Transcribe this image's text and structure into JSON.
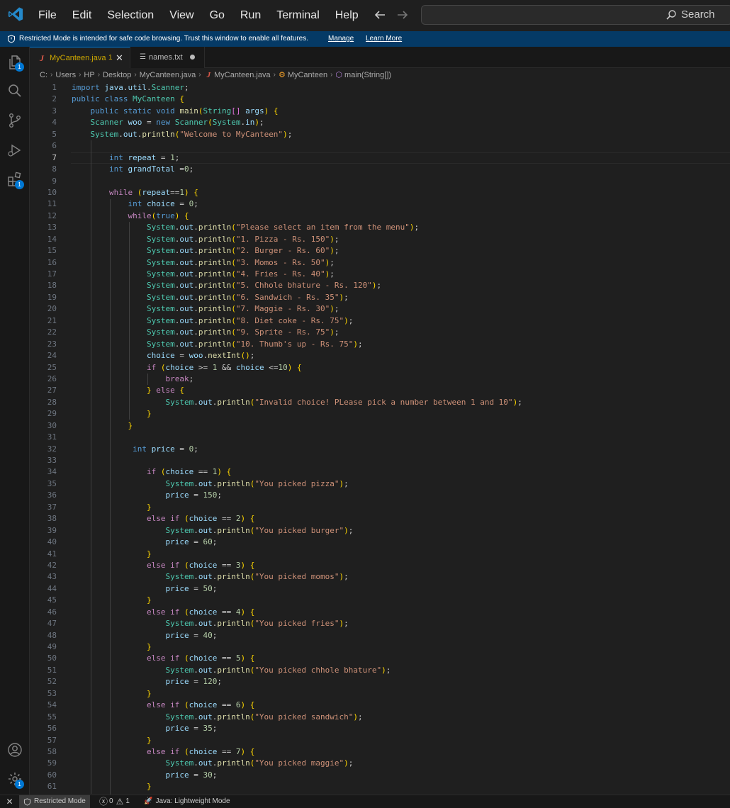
{
  "menu": [
    "File",
    "Edit",
    "Selection",
    "View",
    "Go",
    "Run",
    "Terminal",
    "Help"
  ],
  "search": {
    "label": "Search"
  },
  "banner": {
    "text": "Restricted Mode is intended for safe code browsing. Trust this window to enable all features.",
    "manage": "Manage",
    "learn_more": "Learn More"
  },
  "activity_badges": {
    "explorer": "1",
    "extensions": "1",
    "settings": "1"
  },
  "tabs": [
    {
      "label": "MyCanteen.java",
      "count": "1",
      "close": "✕"
    },
    {
      "label": "names.txt"
    }
  ],
  "breadcrumb": [
    "C:",
    "Users",
    "HP",
    "Desktop",
    "MyCanteen.java",
    "MyCanteen.java",
    "MyCanteen",
    "main(String[])"
  ],
  "editor": {
    "active_line": 7,
    "lines": [
      "import java.util.Scanner;",
      "public class MyCanteen {",
      "    public static void main(String[] args) {",
      "    Scanner woo = new Scanner(System.in);",
      "    System.out.println(\"Welcome to MyCanteen\");",
      "",
      "        int repeat = 1;",
      "        int grandTotal =0;",
      "",
      "        while (repeat==1) {",
      "            int choice = 0;",
      "            while(true) {",
      "                System.out.println(\"Please select an item from the menu\");",
      "                System.out.println(\"1. Pizza - Rs. 150\");",
      "                System.out.println(\"2. Burger - Rs. 60\");",
      "                System.out.println(\"3. Momos - Rs. 50\");",
      "                System.out.println(\"4. Fries - Rs. 40\");",
      "                System.out.println(\"5. Chhole bhature - Rs. 120\");",
      "                System.out.println(\"6. Sandwich - Rs. 35\");",
      "                System.out.println(\"7. Maggie - Rs. 30\");",
      "                System.out.println(\"8. Diet coke - Rs. 75\");",
      "                System.out.println(\"9. Sprite - Rs. 75\");",
      "                System.out.println(\"10. Thumb's up - Rs. 75\");",
      "                choice = woo.nextInt();",
      "                if (choice >= 1 && choice <=10) {",
      "                    break;",
      "                } else {",
      "                    System.out.println(\"Invalid choice! PLease pick a number between 1 and 10\");",
      "                }",
      "            }",
      "",
      "             int price = 0;",
      "",
      "                if (choice == 1) {",
      "                    System.out.println(\"You picked pizza\");",
      "                    price = 150;",
      "                }",
      "                else if (choice == 2) {",
      "                    System.out.println(\"You picked burger\");",
      "                    price = 60;",
      "                }",
      "                else if (choice == 3) {",
      "                    System.out.println(\"You picked momos\");",
      "                    price = 50;",
      "                }",
      "                else if (choice == 4) {",
      "                    System.out.println(\"You picked fries\");",
      "                    price = 40;",
      "                }",
      "                else if (choice == 5) {",
      "                    System.out.println(\"You picked chhole bhature\");",
      "                    price = 120;",
      "                }",
      "                else if (choice == 6) {",
      "                    System.out.println(\"You picked sandwich\");",
      "                    price = 35;",
      "                }",
      "                else if (choice == 7) {",
      "                    System.out.println(\"You picked maggie\");",
      "                    price = 30;",
      "                }"
    ]
  },
  "status": {
    "remote": "✕",
    "restricted": "Restricted Mode",
    "errors": "0",
    "warnings": "1",
    "java": "Java: Lightweight Mode"
  },
  "colors": {
    "accent": "#0078d4",
    "banner": "#053a66",
    "modified_tab": "#cca700"
  },
  "icons": [
    "vscode-logo-icon",
    "arrow-left-icon",
    "arrow-right-icon",
    "search-icon",
    "shield-icon",
    "files-icon",
    "search-view-icon",
    "source-control-icon",
    "run-debug-icon",
    "extensions-icon",
    "account-icon",
    "gear-icon",
    "java-file-icon",
    "text-file-icon",
    "class-icon",
    "method-icon"
  ]
}
